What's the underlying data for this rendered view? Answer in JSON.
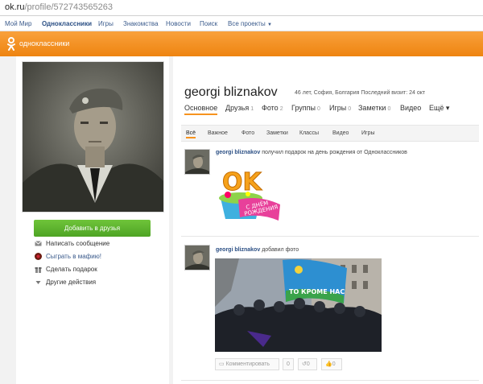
{
  "browser": {
    "url_host": "ok.ru",
    "url_path": "/profile/572743565263"
  },
  "topnav": {
    "items": [
      "Мой Мир",
      "Одноклассники",
      "Игры",
      "Знакомства",
      "Новости",
      "Поиск",
      "Все проекты"
    ]
  },
  "header": {
    "brand": "одноклассники",
    "color": "#f7931e"
  },
  "profile": {
    "name": "georgi bliznakov",
    "meta": "46 лет, София, Болгария Последний визит: 24 окт",
    "add_friend": "Добавить в друзья",
    "side_links": [
      "Написать сообщение",
      "Сыграть в мафию!",
      "Сделать подарок",
      "Другие действия"
    ],
    "tabs": [
      {
        "label": "Основное",
        "count": ""
      },
      {
        "label": "Друзья",
        "count": "1"
      },
      {
        "label": "Фото",
        "count": "2"
      },
      {
        "label": "Группы",
        "count": "0"
      },
      {
        "label": "Игры",
        "count": "0"
      },
      {
        "label": "Заметки",
        "count": "0"
      },
      {
        "label": "Видео",
        "count": ""
      },
      {
        "label": "Ещё ▾",
        "count": ""
      }
    ]
  },
  "feed": {
    "filters": [
      "Всё",
      "Важное",
      "Фото",
      "Заметки",
      "Классы",
      "Видео",
      "Игры"
    ],
    "posts": [
      {
        "author": "georgi bliznakov",
        "text": "получил подарок на день рождения от Одноклассников",
        "gift_ok": "OK",
        "gift_line1": "С ДНЁМ",
        "gift_line2": "РОЖДЕНИЯ"
      },
      {
        "author": "georgi bliznakov",
        "text": "добавил фото",
        "flag_text": "ТО КРОМЕ НАС"
      }
    ],
    "actions": {
      "comment": "Комментировать",
      "comment_count": "0",
      "share_count": "0",
      "like_count": "0"
    }
  }
}
